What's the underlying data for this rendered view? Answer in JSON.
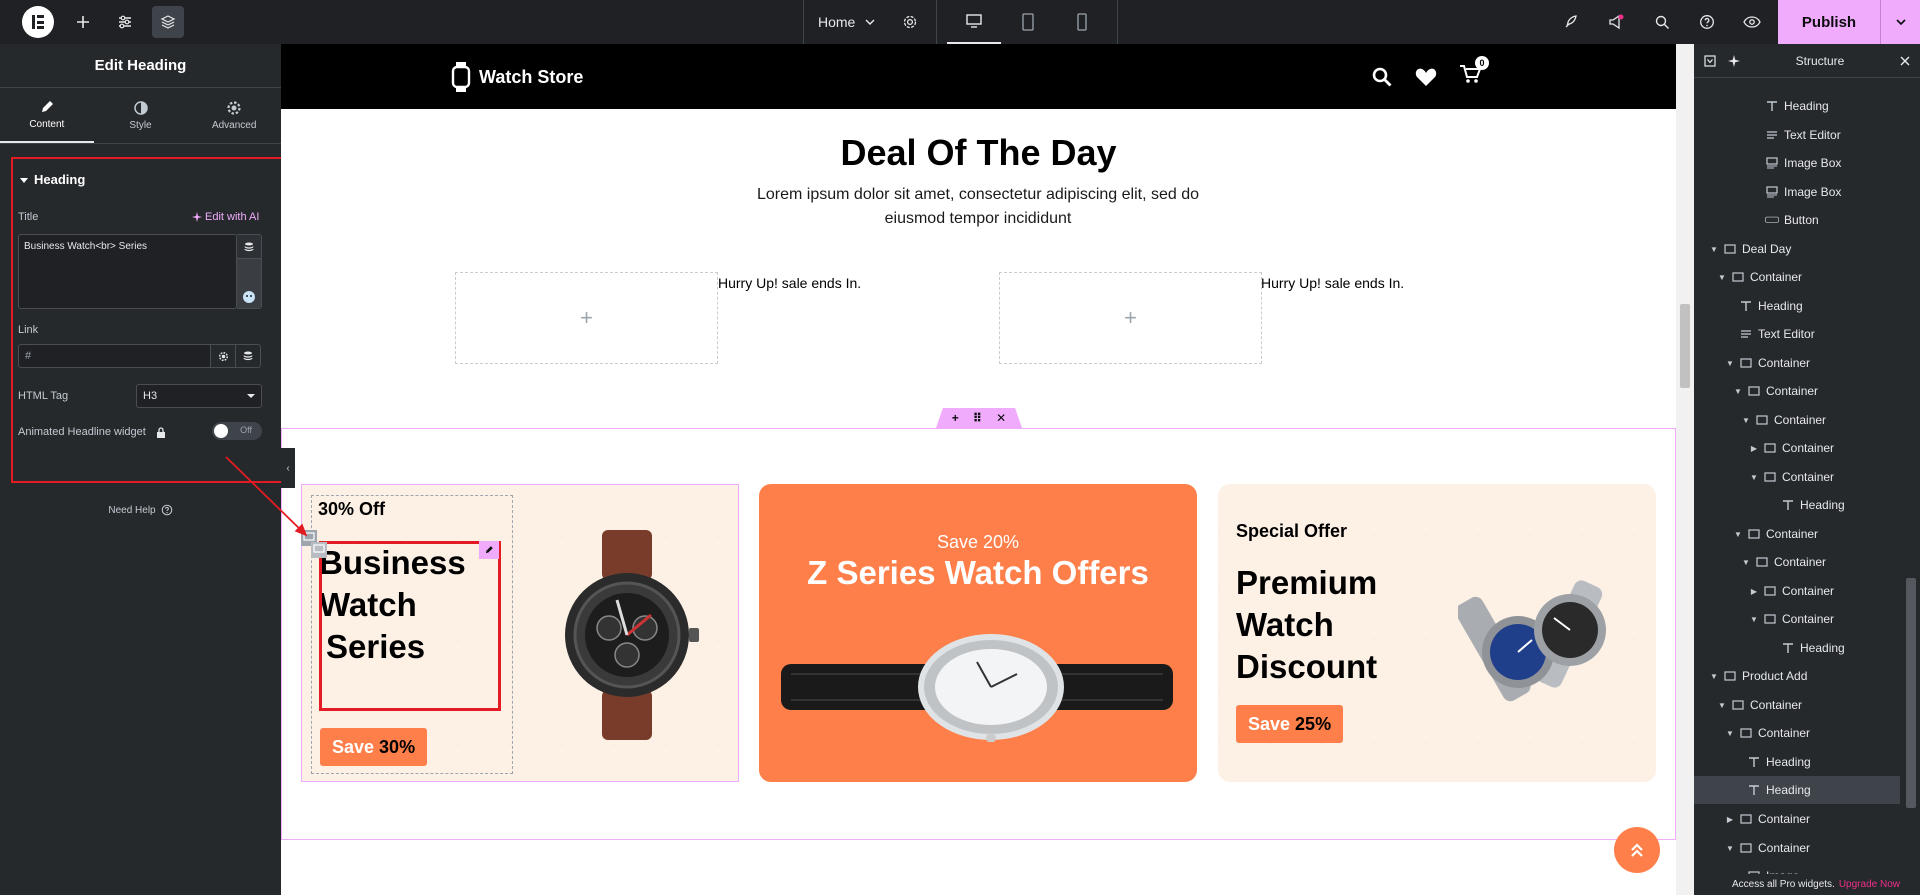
{
  "topbar": {
    "home_label": "Home",
    "publish_label": "Publish"
  },
  "left_panel": {
    "title": "Edit Heading",
    "tabs": [
      {
        "label": "Content"
      },
      {
        "label": "Style"
      },
      {
        "label": "Advanced"
      }
    ],
    "section_title": "Heading",
    "title_label": "Title",
    "edit_ai_label": "Edit with AI",
    "title_value": "Business Watch<br> Series",
    "link_label": "Link",
    "link_placeholder": "#",
    "html_tag_label": "HTML Tag",
    "html_tag_value": "H3",
    "animated_label": "Animated Headline widget",
    "toggle_text": "Off",
    "need_help": "Need Help"
  },
  "canvas": {
    "brand": "Watch Store",
    "cart_count": "0",
    "deal_title": "Deal Of The Day",
    "deal_subtitle": "Lorem ipsum dolor sit amet, consectetur adipiscing elit, sed do eiusmod tempor incididunt",
    "hurry_text_1": "Hurry Up! sale ends In.",
    "hurry_text_2": "Hurry Up! sale ends In.",
    "card1": {
      "kicker": "30% Off",
      "heading_l1": "Business",
      "heading_l2": "Watch",
      "heading_l3": "Series",
      "save": "Save",
      "save_pct": "30%"
    },
    "card2": {
      "kicker": "Save 20%",
      "heading": "Z Series Watch Offers"
    },
    "card3": {
      "kicker": "Special Offer",
      "heading_l1": "Premium",
      "heading_l2": "Watch",
      "heading_l3": "Discount",
      "save": "Save",
      "save_pct": "25%"
    }
  },
  "structure": {
    "title": "Structure",
    "nodes": [
      {
        "label": "Heading",
        "depth": 4,
        "arrow": "",
        "icon": "heading-icon"
      },
      {
        "label": "Text Editor",
        "depth": 4,
        "arrow": "",
        "icon": "text-editor-icon"
      },
      {
        "label": "Image Box",
        "depth": 4,
        "arrow": "",
        "icon": "image-box-icon"
      },
      {
        "label": "Image Box",
        "depth": 4,
        "arrow": "",
        "icon": "image-box-icon"
      },
      {
        "label": "Button",
        "depth": 4,
        "arrow": "",
        "icon": "button-icon"
      },
      {
        "label": "Deal Day",
        "depth": 0,
        "arrow": "▼",
        "icon": "container-icon"
      },
      {
        "label": "Container",
        "depth": 1,
        "arrow": "▼",
        "icon": "container-icon"
      },
      {
        "label": "Heading",
        "depth": 2,
        "arrow": "",
        "icon": "heading-icon"
      },
      {
        "label": "Text Editor",
        "depth": 2,
        "arrow": "",
        "icon": "text-editor-icon"
      },
      {
        "label": "Container",
        "depth": 2,
        "arrow": "▼",
        "icon": "container-icon"
      },
      {
        "label": "Container",
        "depth": 3,
        "arrow": "▼",
        "icon": "container-icon"
      },
      {
        "label": "Container",
        "depth": 4,
        "arrow": "▼",
        "icon": "container-icon"
      },
      {
        "label": "Container",
        "depth": 5,
        "arrow": "▶",
        "icon": "container-icon"
      },
      {
        "label": "Container",
        "depth": 5,
        "arrow": "▼",
        "icon": "container-icon"
      },
      {
        "label": "Heading",
        "depth": 6,
        "arrow": "",
        "icon": "heading-icon"
      },
      {
        "label": "Container",
        "depth": 3,
        "arrow": "▼",
        "icon": "container-icon"
      },
      {
        "label": "Container",
        "depth": 4,
        "arrow": "▼",
        "icon": "container-icon"
      },
      {
        "label": "Container",
        "depth": 5,
        "arrow": "▶",
        "icon": "container-icon"
      },
      {
        "label": "Container",
        "depth": 5,
        "arrow": "▼",
        "icon": "container-icon"
      },
      {
        "label": "Heading",
        "depth": 6,
        "arrow": "",
        "icon": "heading-icon"
      },
      {
        "label": "Product Add",
        "depth": 0,
        "arrow": "▼",
        "icon": "container-icon"
      },
      {
        "label": "Container",
        "depth": 1,
        "arrow": "▼",
        "icon": "container-icon"
      },
      {
        "label": "Container",
        "depth": 2,
        "arrow": "▼",
        "icon": "container-icon"
      },
      {
        "label": "Heading",
        "depth": 3,
        "arrow": "",
        "icon": "heading-icon"
      },
      {
        "label": "Heading",
        "depth": 3,
        "arrow": "",
        "icon": "heading-icon",
        "selected": true
      },
      {
        "label": "Container",
        "depth": 2,
        "arrow": "▶",
        "icon": "container-icon"
      },
      {
        "label": "Container",
        "depth": 2,
        "arrow": "▼",
        "icon": "container-icon"
      },
      {
        "label": "Image",
        "depth": 3,
        "arrow": "",
        "icon": "image-icon"
      }
    ],
    "footer_text": "Access all Pro widgets.",
    "footer_link": "Upgrade Now"
  },
  "colors": {
    "accent": "#f0abfc",
    "orange": "#fe7f4a",
    "selection_red": "#e31b23",
    "editor_dark": "#26292c"
  }
}
